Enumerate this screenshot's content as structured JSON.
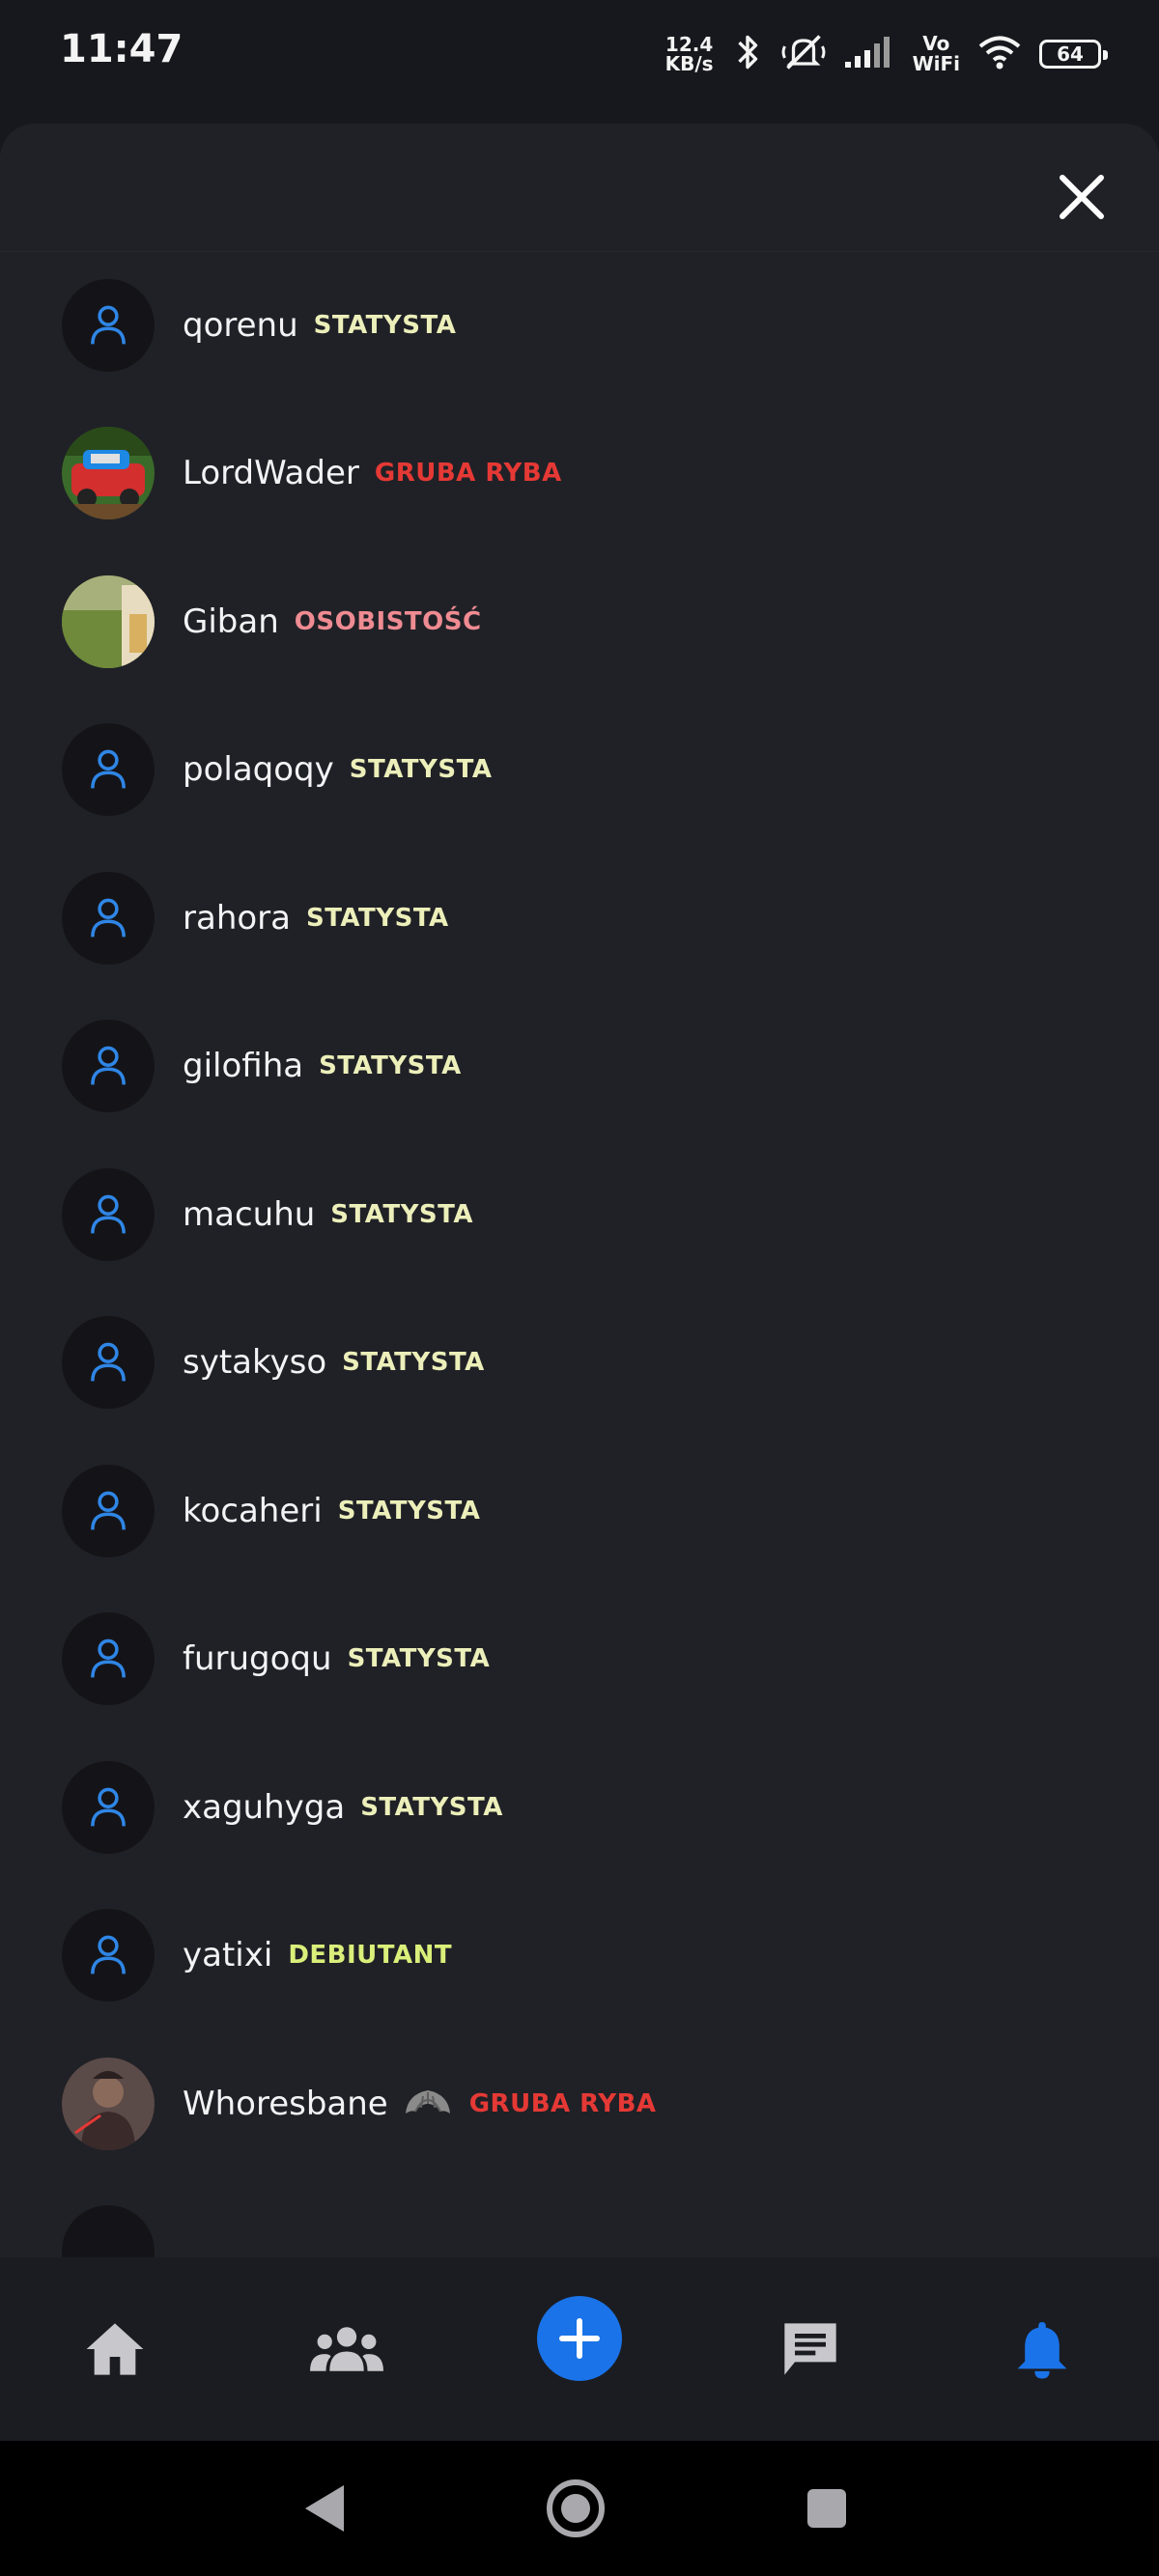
{
  "status_bar": {
    "time": "11:47",
    "net_speed_value": "12.4",
    "net_speed_unit": "KB/s",
    "vowifi_top": "Vo",
    "vowifi_bottom": "WiFi",
    "battery": "64"
  },
  "sheet": {
    "close_icon": "close-icon"
  },
  "users": [
    {
      "name": "qorenu",
      "rank": "STATYSTA",
      "avatar": "default"
    },
    {
      "name": "LordWader",
      "rank": "GRUBA RYBA",
      "avatar": "photo-car"
    },
    {
      "name": "Giban",
      "rank": "OSOBISTOŚĆ",
      "avatar": "photo-field"
    },
    {
      "name": "polaqoqy",
      "rank": "STATYSTA",
      "avatar": "default"
    },
    {
      "name": "rahora",
      "rank": "STATYSTA",
      "avatar": "default"
    },
    {
      "name": "gilofiha",
      "rank": "STATYSTA",
      "avatar": "default"
    },
    {
      "name": "macuhu",
      "rank": "STATYSTA",
      "avatar": "default"
    },
    {
      "name": "sytakyso",
      "rank": "STATYSTA",
      "avatar": "default"
    },
    {
      "name": "kocaheri",
      "rank": "STATYSTA",
      "avatar": "default"
    },
    {
      "name": "furugoqu",
      "rank": "STATYSTA",
      "avatar": "default"
    },
    {
      "name": "xaguhyga",
      "rank": "STATYSTA",
      "avatar": "default"
    },
    {
      "name": "yatixi",
      "rank": "DEBIUTANT",
      "avatar": "default"
    },
    {
      "name": "Whoresbane",
      "rank": "GRUBA RYBA",
      "avatar": "photo-warrior",
      "badge": "croissant-icon"
    }
  ],
  "colors": {
    "statysta": "#ecefb9",
    "gruba_ryba": "#e53935",
    "osobistosc": "#ef8b92",
    "debiutant": "#d9ef7a",
    "accent": "#1a73e8"
  },
  "bottom_nav": {
    "items": [
      "home-icon",
      "people-icon",
      "add-icon",
      "chat-icon",
      "bell-icon"
    ],
    "active": "bell-icon"
  },
  "system_nav": [
    "back-icon",
    "home-circle-icon",
    "recents-icon"
  ]
}
